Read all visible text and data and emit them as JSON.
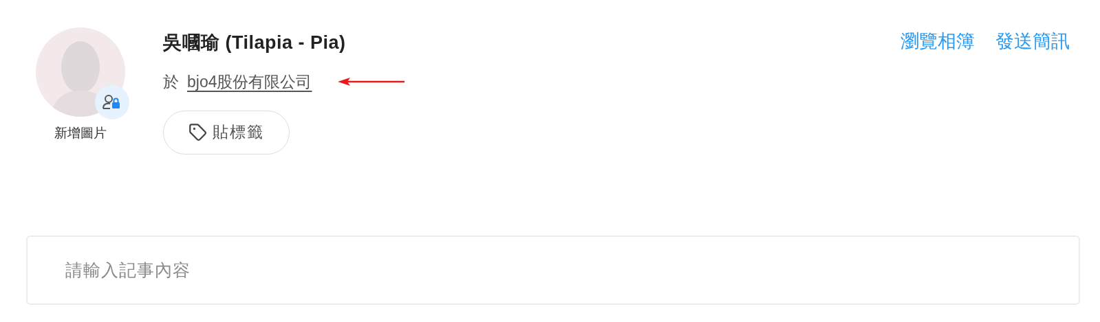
{
  "profile": {
    "name": "吳嘓瑜 (Tilapia - Pia)",
    "company_prefix": "於",
    "company": "bjo4股份有限公司",
    "add_picture": "新增圖片",
    "tag_button": "貼標籤"
  },
  "actions": [
    "瀏覽相簿",
    "發送簡訊"
  ],
  "note": {
    "placeholder": "請輸入記事內容"
  }
}
